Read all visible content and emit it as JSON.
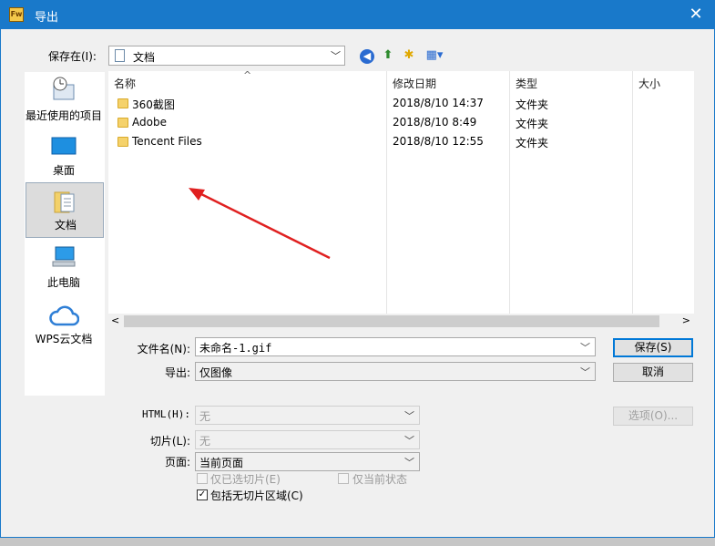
{
  "window": {
    "title": "导出",
    "app_icon_text": "Fw",
    "close_symbol": "✕"
  },
  "toolbar": {
    "save_in_label": "保存在(I):",
    "save_in_value": "文档",
    "icons": [
      "back-icon",
      "up-folder-icon",
      "new-folder-icon",
      "view-menu-icon"
    ]
  },
  "places": [
    {
      "name": "最近使用的项目",
      "icon": "recent-icon"
    },
    {
      "name": "桌面",
      "icon": "desktop-icon"
    },
    {
      "name": "文档",
      "icon": "documents-icon",
      "selected": true
    },
    {
      "name": "此电脑",
      "icon": "computer-icon"
    },
    {
      "name": "WPS云文档",
      "icon": "cloud-icon"
    }
  ],
  "file_list": {
    "columns": [
      "名称",
      "修改日期",
      "类型",
      "大小"
    ],
    "rows": [
      {
        "name": "360截图",
        "date": "2018/8/10 14:37",
        "type": "文件夹",
        "size": ""
      },
      {
        "name": "Adobe",
        "date": "2018/8/10 8:49",
        "type": "文件夹",
        "size": ""
      },
      {
        "name": "Tencent Files",
        "date": "2018/8/10 12:55",
        "type": "文件夹",
        "size": ""
      }
    ]
  },
  "form": {
    "filename_label": "文件名(N):",
    "filename_value": "未命名-1.gif",
    "export_label": "导出:",
    "export_value": "仅图像",
    "html_label": "HTML(H):",
    "html_value": "无",
    "slices_label": "切片(L):",
    "slices_value": "无",
    "pages_label": "页面:",
    "pages_value": "当前页面",
    "chk_selected_slices": "仅已选切片(E)",
    "chk_current_state": "仅当前状态",
    "chk_include_no_slice": "包括无切片区域(C)",
    "chk_include_no_slice_checked": true
  },
  "buttons": {
    "save": "保存(S)",
    "cancel": "取消",
    "options": "选项(O)..."
  },
  "colors": {
    "titlebar": "#1979ca",
    "annotation_arrow": "#e02020"
  }
}
